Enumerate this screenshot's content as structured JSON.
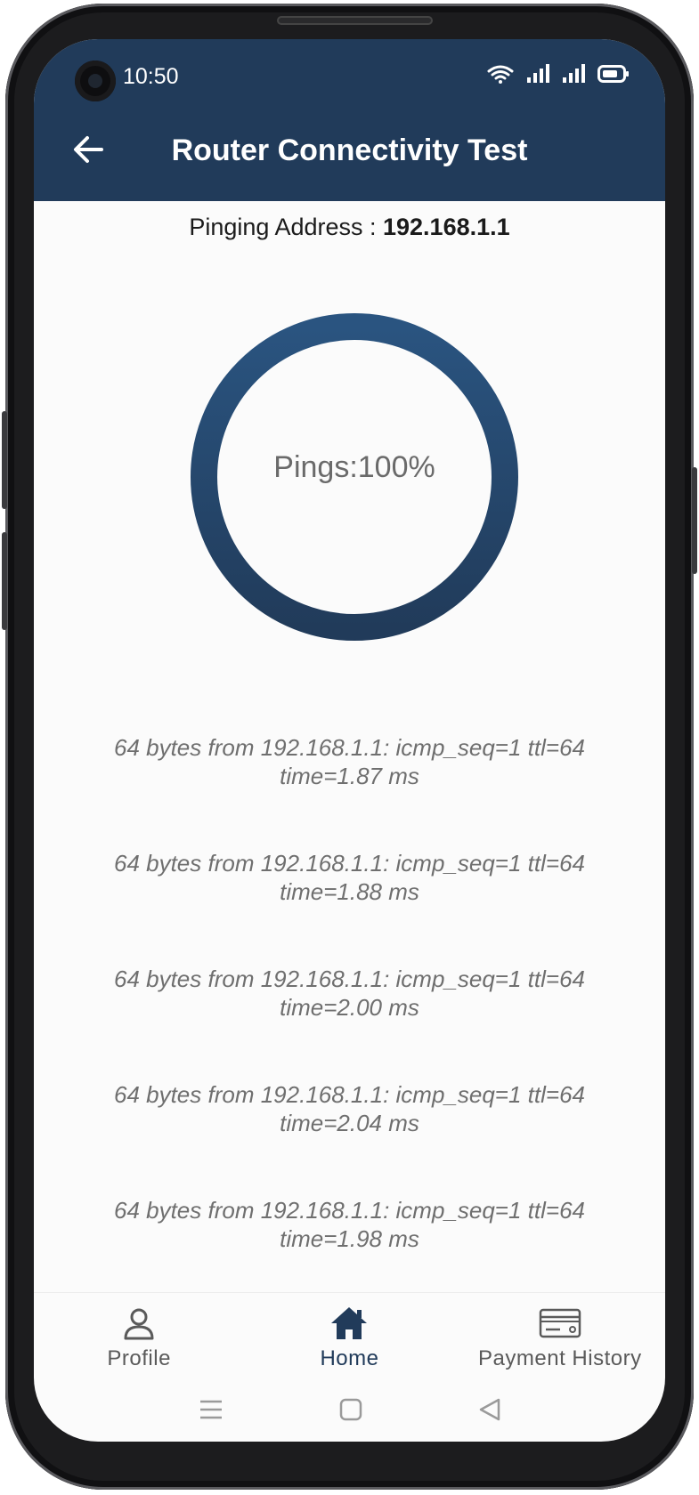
{
  "status_bar": {
    "time": "10:50",
    "icons": [
      "wifi-icon",
      "signal-icon",
      "signal-icon",
      "battery-icon"
    ]
  },
  "app_bar": {
    "title": "Router Connectivity Test",
    "back_icon": "arrow-left-icon"
  },
  "pinging": {
    "label": "Pinging Address : ",
    "address": "192.168.1.1"
  },
  "progress": {
    "label": "Pings:100%",
    "fraction": 1.0,
    "color_start": "#213b5a",
    "color_end": "#2a5480"
  },
  "ping_results": [
    {
      "line1": "64 bytes from 192.168.1.1: icmp_seq=1 ttl=64",
      "line2": "time=1.87 ms"
    },
    {
      "line1": "64 bytes from 192.168.1.1: icmp_seq=1 ttl=64",
      "line2": "time=1.88 ms"
    },
    {
      "line1": "64 bytes from 192.168.1.1: icmp_seq=1 ttl=64",
      "line2": "time=2.00 ms"
    },
    {
      "line1": "64 bytes from 192.168.1.1: icmp_seq=1 ttl=64",
      "line2": "time=2.04 ms"
    },
    {
      "line1": "64 bytes from 192.168.1.1: icmp_seq=1 ttl=64",
      "line2": "time=1.98 ms"
    }
  ],
  "bottom_nav": {
    "items": [
      {
        "label": "Profile",
        "icon": "person-icon"
      },
      {
        "label": "Home",
        "icon": "home-icon"
      },
      {
        "label": "Payment History",
        "icon": "credit-card-icon"
      }
    ],
    "active_index": 1
  },
  "system_nav": {
    "icons": [
      "menu-icon",
      "square-icon",
      "triangle-back-icon"
    ]
  },
  "colors": {
    "header_bg": "#213b5a",
    "accent": "#213b5a",
    "text_muted": "#6f6f6f"
  }
}
